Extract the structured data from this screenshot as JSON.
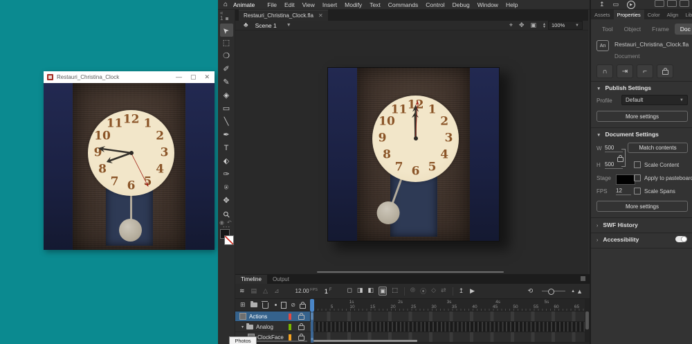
{
  "colors": {
    "desktop_teal": "#0b8a90",
    "app_bg": "#2d2d2d",
    "selection_blue": "#35628c",
    "playhead_blue": "#4a86c8",
    "stage_color_swatch": "#000000",
    "layer_chip_actions": "#e8483f",
    "layer_chip_analog": "#7ab800",
    "layer_chip_clockface": "#f5a623"
  },
  "preview_window": {
    "title": "Restauri_Christina_Clock",
    "minimize": "—",
    "maximize": "▢",
    "close": "✕"
  },
  "menubar": {
    "home_icon": "⌂",
    "app_name": "Animate",
    "items": [
      "File",
      "Edit",
      "View",
      "Insert",
      "Modify",
      "Text",
      "Commands",
      "Control",
      "Debug",
      "Window",
      "Help"
    ]
  },
  "document_tab": {
    "name": "Restauri_Christina_Clock.fla",
    "close": "✕"
  },
  "edit_bar": {
    "scene_icon": "♣",
    "scene_label": "Scene 1",
    "chevron": "▼",
    "center_stage_icon": "⌖",
    "rotation_icon": "✥",
    "clip_icon": "▣",
    "zoom_value": "100%"
  },
  "tools": [
    {
      "name": "selection-tool",
      "glyph": "➤",
      "selected": true
    },
    {
      "name": "subselection-tool",
      "glyph": "⬚"
    },
    {
      "name": "lasso-tool",
      "glyph": "❍"
    },
    {
      "name": "fluid-brush-tool",
      "glyph": "✐"
    },
    {
      "name": "classic-brush-tool",
      "glyph": "✎"
    },
    {
      "name": "eraser-tool",
      "glyph": "◈"
    },
    {
      "name": "rectangle-tool",
      "glyph": "▭"
    },
    {
      "name": "line-tool",
      "glyph": "╲"
    },
    {
      "name": "pen-tool",
      "glyph": "✒"
    },
    {
      "name": "text-tool",
      "glyph": "T"
    },
    {
      "name": "paint-bucket-tool",
      "glyph": "⬖"
    },
    {
      "name": "eyedropper-tool",
      "glyph": "✑"
    },
    {
      "name": "asset-warp-tool",
      "glyph": "⍟"
    },
    {
      "name": "hand-tool",
      "glyph": "✥"
    },
    {
      "name": "zoom-tool",
      "glyph": "⚲"
    },
    {
      "name": "edit-toolbar",
      "glyph": "⋯",
      "dim": true
    }
  ],
  "tools_header": {
    "collapse": "«",
    "count": "1"
  },
  "clock": {
    "numerals": [
      "12",
      "1",
      "2",
      "3",
      "4",
      "5",
      "6",
      "7",
      "8",
      "9",
      "10",
      "11"
    ],
    "preview": {
      "hour_angle": 250,
      "minute_angle": 278,
      "second_angle": 153,
      "pendulum_angle": 0
    },
    "stage": {
      "hour_angle": 359,
      "minute_angle": 0,
      "second_angle": 3,
      "pendulum_angle": 20
    }
  },
  "timeline": {
    "tabs": [
      "Timeline",
      "Output"
    ],
    "active_tab": "Timeline",
    "left_icons": [
      {
        "name": "onion-skin-icon",
        "glyph": "≋"
      },
      {
        "name": "camera-icon",
        "glyph": "▤",
        "dim": true
      },
      {
        "name": "advanced-layers-icon",
        "glyph": "△",
        "dim": true
      },
      {
        "name": "graph-editor-icon",
        "glyph": "⊿",
        "dim": true
      }
    ],
    "fps_value": "12.00",
    "fps_unit": "FPS",
    "frame_value": "1",
    "frame_unit": "F",
    "frame_buttons": [
      {
        "name": "insert-frame-icon",
        "glyph": "◻"
      },
      {
        "name": "insert-keyframe-icon",
        "glyph": "◨"
      },
      {
        "name": "insert-blank-keyframe-icon",
        "glyph": "◧"
      },
      {
        "name": "auto-keyframe-icon",
        "glyph": "▣",
        "selected": true
      },
      {
        "name": "delete-frame-icon",
        "glyph": "⬚"
      }
    ],
    "tween-buttons": [
      {
        "name": "create-motion-tween-icon",
        "glyph": "⦾"
      },
      {
        "name": "create-shape-tween-icon",
        "glyph": "⦿"
      },
      {
        "name": "create-classic-tween-icon",
        "glyph": "◇"
      },
      {
        "name": "tween-options-icon",
        "glyph": "⇄"
      }
    ],
    "export_icon": "↥",
    "play_icon": "▶",
    "loop_icon": "⟲",
    "layer_header_icons": {
      "add_layer": "⊞",
      "highlight_dot": "·",
      "outline": "▯",
      "hide": "⊘"
    },
    "layers": [
      {
        "name": "Actions",
        "type": "layer",
        "chip": "#e8483f",
        "selected": true,
        "indent": 0,
        "frames": "marks",
        "marker": "script"
      },
      {
        "name": "Analog",
        "type": "folder",
        "chip": "#7ab800",
        "selected": false,
        "indent": 0,
        "frames": "dense",
        "marker": "",
        "expanded": true
      },
      {
        "name": "ClockFace",
        "type": "layer",
        "chip": "#f5a623",
        "selected": false,
        "indent": 1,
        "frames": "marks",
        "marker": "keyframe"
      }
    ],
    "ruler_numbers": [
      "5",
      "10",
      "15",
      "20",
      "25",
      "30",
      "35",
      "40",
      "45",
      "50",
      "55",
      "60",
      "65"
    ],
    "ruler_seconds": [
      "1s",
      "2s",
      "3s",
      "4s",
      "5s"
    ]
  },
  "properties_panel": {
    "top_icons": {
      "share": "↥",
      "monitor": "▭",
      "test_movie": "▶"
    },
    "tabs": [
      "Assets",
      "Properties",
      "Color",
      "Align",
      "Library"
    ],
    "active_tab": "Properties",
    "panel_menu_icon": "≡",
    "subtabs": [
      "Tool",
      "Object",
      "Frame",
      "Doc"
    ],
    "active_subtab": "Doc",
    "badge": "An",
    "file_name": "Restauri_Christina_Clock.fla",
    "file_kind": "Document",
    "snap_icons": [
      {
        "name": "snap-magnet-icon",
        "glyph": "∩"
      },
      {
        "name": "snap-align-icon",
        "glyph": "⇥"
      },
      {
        "name": "snap-objects-icon",
        "glyph": "⌐"
      },
      {
        "name": "lock-guides-icon",
        "glyph": ""
      }
    ],
    "publish": {
      "header": "Publish Settings",
      "chevron": "▼",
      "profile_label": "Profile",
      "profile_value": "Default",
      "more_button": "More settings"
    },
    "document": {
      "header": "Document Settings",
      "chevron": "▼",
      "w_label": "W",
      "w_value": "500",
      "h_label": "H",
      "h_value": "500",
      "match_button": "Match contents",
      "scale_content": "Scale Content",
      "stage_label": "Stage",
      "apply_pasteboard": "Apply to pasteboard",
      "fps_label": "FPS",
      "fps_value": "12",
      "scale_spans": "Scale Spans",
      "more_button": "More settings"
    },
    "swf_history": {
      "header": "SWF History",
      "chevron": "›"
    },
    "accessibility": {
      "header": "Accessibility",
      "chevron": "›",
      "toggle_on": true
    }
  },
  "taskbar_tooltip": "Photos"
}
